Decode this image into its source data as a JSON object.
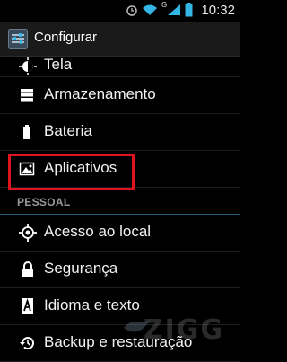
{
  "status_bar": {
    "time": "10:32",
    "network_label": "G",
    "icons": [
      "alarm-icon",
      "wifi-icon",
      "signal-icon",
      "battery-icon"
    ]
  },
  "action_bar": {
    "title": "Configurar",
    "icon": "settings-icon"
  },
  "settings": {
    "items": [
      {
        "label": "Tela",
        "icon": "display-icon"
      },
      {
        "label": "Armazenamento",
        "icon": "storage-icon"
      },
      {
        "label": "Bateria",
        "icon": "battery-icon"
      },
      {
        "label": "Aplicativos",
        "icon": "apps-icon",
        "highlighted": true
      }
    ],
    "section_personal": "PESSOAL",
    "personal_items": [
      {
        "label": "Acesso ao local",
        "icon": "location-icon"
      },
      {
        "label": "Segurança",
        "icon": "lock-icon"
      },
      {
        "label": "Idioma e texto",
        "icon": "language-icon"
      },
      {
        "label": "Backup e restauração",
        "icon": "backup-icon"
      }
    ]
  },
  "watermark": {
    "text": "ZIGG"
  },
  "colors": {
    "highlight": "#e0141e",
    "background": "#000000",
    "divider_section": "#2c5f75"
  }
}
